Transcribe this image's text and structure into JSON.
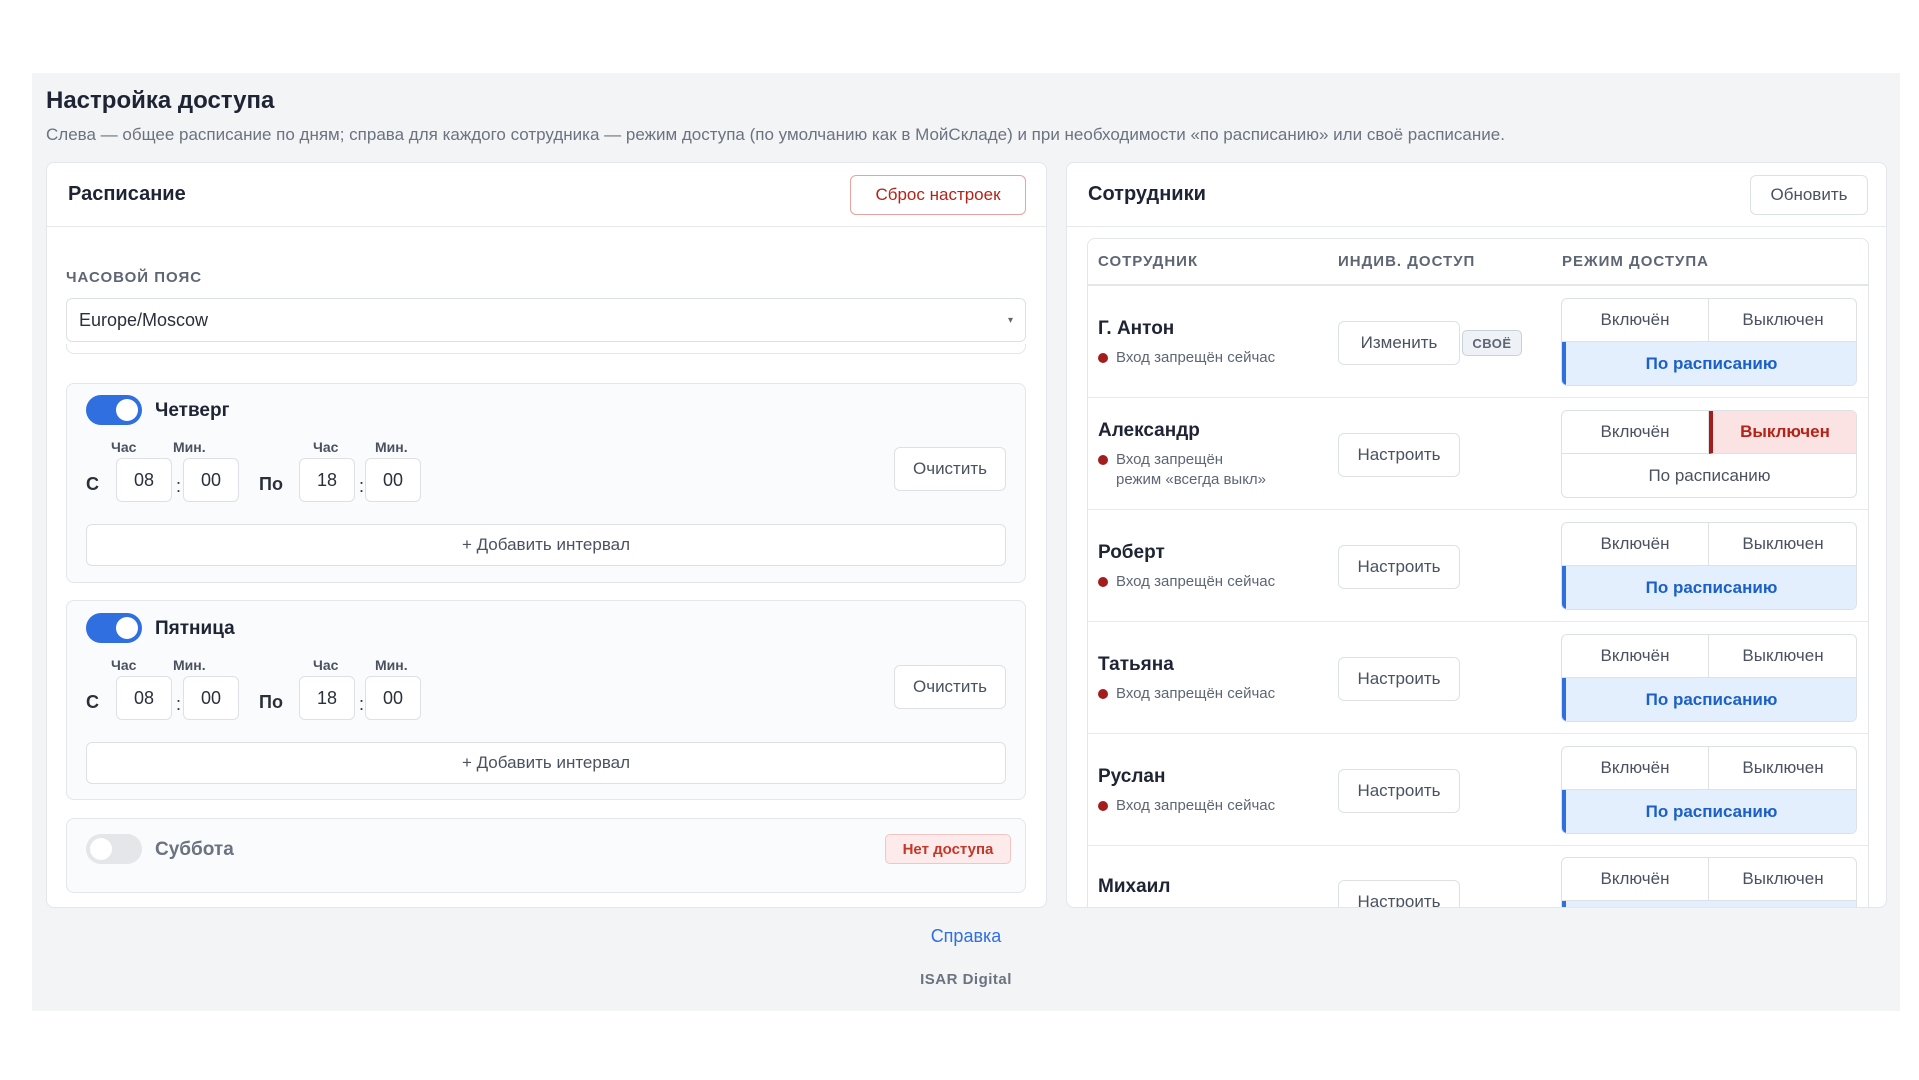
{
  "page": {
    "title": "Настройка доступа",
    "description": "Слева — общее расписание по дням; справа для каждого сотрудника — режим доступа (по умолчанию как в МойСкладе) и при необходимости «по расписанию» или своё расписание."
  },
  "schedule": {
    "title": "Расписание",
    "reset_label": "Сброс настроек",
    "timezone_label": "ЧАСОВОЙ ПОЯС",
    "timezone_value": "Europe/Moscow",
    "labels": {
      "from": "С",
      "to": "По",
      "hour": "Час",
      "minute": "Мин.",
      "colon": ":",
      "clear": "Очистить",
      "add_interval": "+ Добавить интервал"
    },
    "days": [
      {
        "name": "Четверг",
        "enabled": true,
        "from_h": "08",
        "from_m": "00",
        "to_h": "18",
        "to_m": "00"
      },
      {
        "name": "Пятница",
        "enabled": true,
        "from_h": "08",
        "from_m": "00",
        "to_h": "18",
        "to_m": "00"
      },
      {
        "name": "Суббота",
        "enabled": false,
        "badge": "Нет доступа"
      }
    ]
  },
  "employees": {
    "title": "Сотрудники",
    "refresh_label": "Обновить",
    "columns": [
      "СОТРУДНИК",
      "ИНДИВ. ДОСТУП",
      "РЕЖИМ ДОСТУПА"
    ],
    "mode_labels": {
      "on": "Включён",
      "off": "Выключен",
      "schedule": "По расписанию"
    },
    "rows": [
      {
        "name": "Г. Антон",
        "status": "Вход запрещён сейчас",
        "action": "Изменить",
        "tag": "СВОЁ",
        "mode": "schedule"
      },
      {
        "name": "Александр",
        "status": "Вход запрещён",
        "status2": "режим «всегда выкл»",
        "action": "Настроить",
        "mode": "off"
      },
      {
        "name": "Роберт",
        "status": "Вход запрещён сейчас",
        "action": "Настроить",
        "mode": "schedule"
      },
      {
        "name": "Татьяна",
        "status": "Вход запрещён сейчас",
        "action": "Настроить",
        "mode": "schedule"
      },
      {
        "name": "Руслан",
        "status": "Вход запрещён сейчас",
        "action": "Настроить",
        "mode": "schedule"
      },
      {
        "name": "Михаил",
        "action": "Настроить",
        "mode": "schedule"
      }
    ]
  },
  "footer": {
    "help": "Справка",
    "brand": "ISAR Digital"
  },
  "colors": {
    "accent": "#2f6fe0",
    "danger": "#b42318",
    "schedule_bg": "#e4effd",
    "off_bg": "#fbe3e3"
  }
}
